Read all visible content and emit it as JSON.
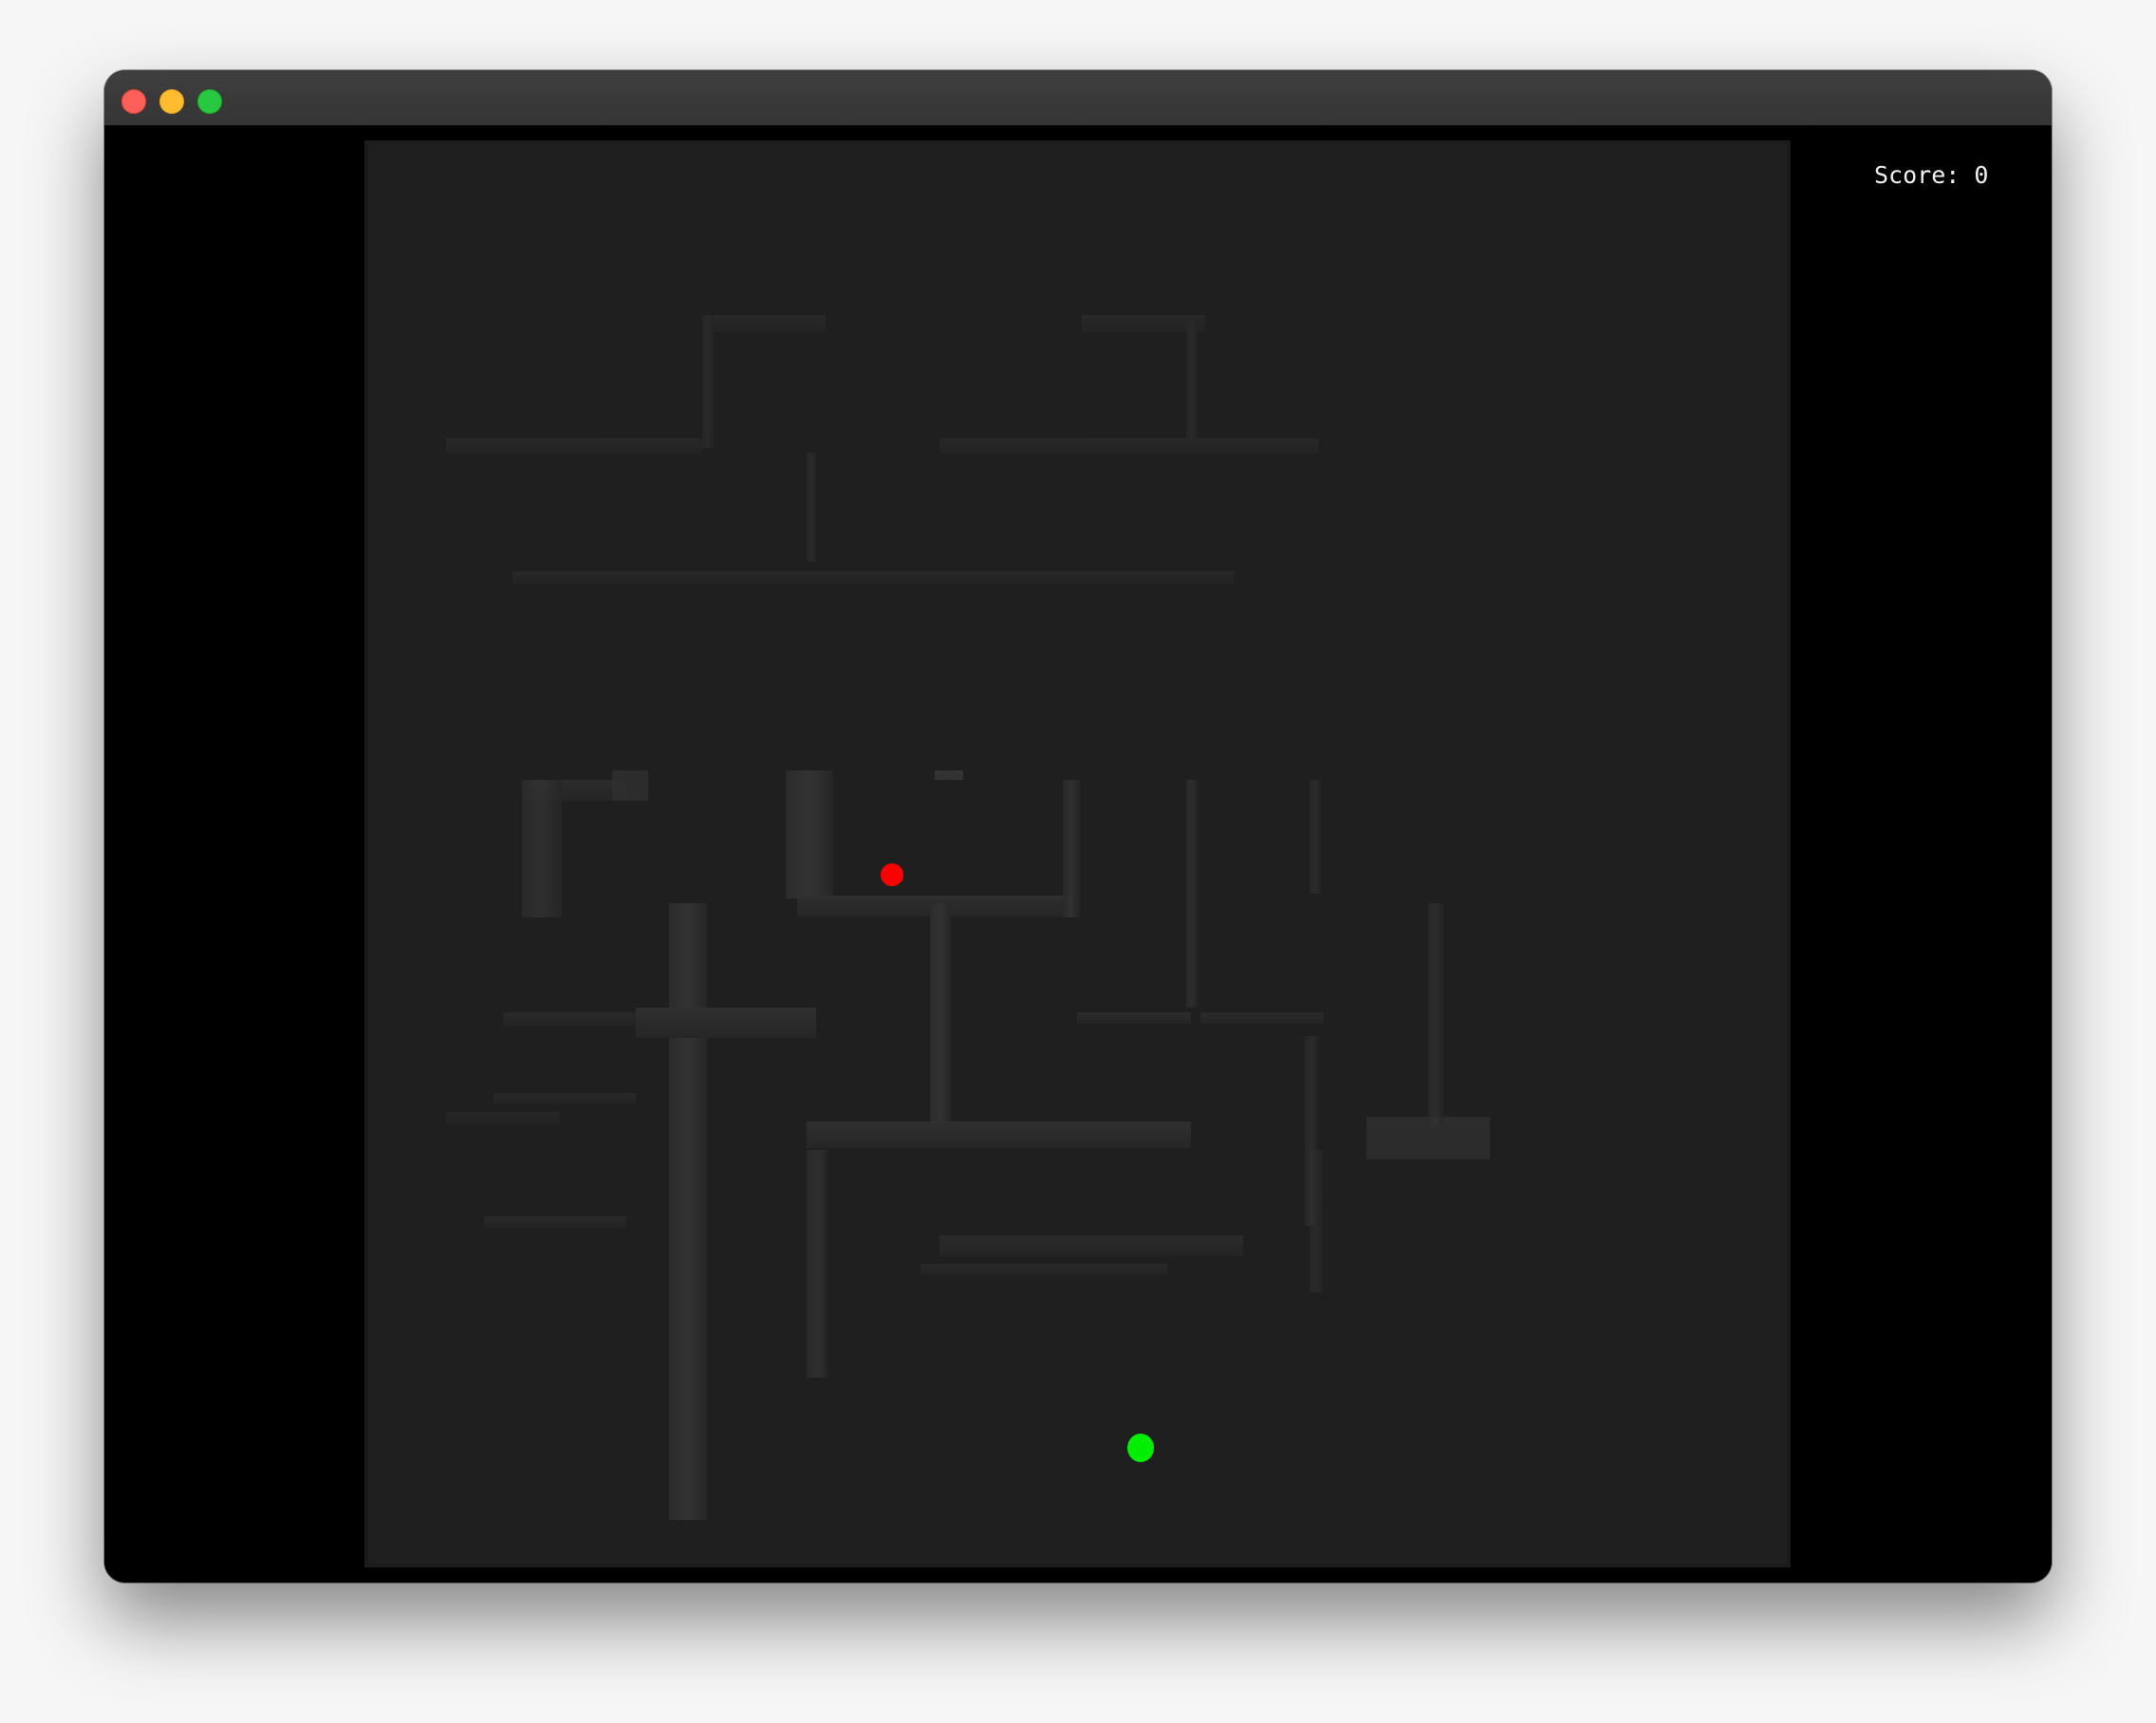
{
  "window": {
    "controls": [
      "close",
      "minimize",
      "maximize"
    ]
  },
  "hud": {
    "score_label": "Score: 0",
    "score": 0
  },
  "game": {
    "board_color": "#1e1e1e",
    "wall_color": "#2a2a2a",
    "enemy": {
      "color": "#ff0000",
      "shape": "circle"
    },
    "player": {
      "color": "#00ee00",
      "shape": "circle"
    }
  }
}
